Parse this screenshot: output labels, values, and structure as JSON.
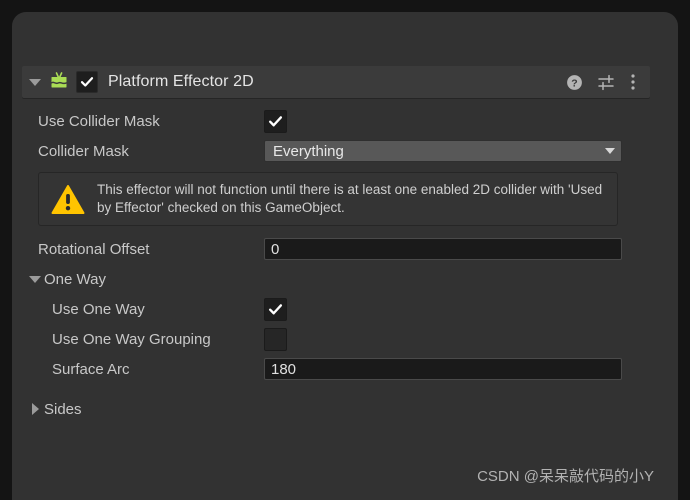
{
  "component": {
    "title": "Platform Effector 2D",
    "icon_name": "platform-effector-2d-icon",
    "enabled": true,
    "expanded": true,
    "tools": {
      "help_label": "?",
      "help_icon": "help-icon",
      "preset_icon": "preset-settings-icon",
      "menu_icon": "more-options-icon"
    }
  },
  "properties": {
    "use_collider_mask": {
      "label": "Use Collider Mask",
      "checked": true
    },
    "collider_mask": {
      "label": "Collider Mask",
      "value": "Everything"
    },
    "rotational_offset": {
      "label": "Rotational Offset",
      "value": "0"
    },
    "surface_arc": {
      "label": "Surface Arc",
      "value": "180"
    },
    "use_one_way": {
      "label": "Use One Way",
      "checked": true
    },
    "use_one_way_grouping": {
      "label": "Use One Way Grouping",
      "checked": false
    }
  },
  "warning": {
    "icon_name": "warning-triangle-icon",
    "text": "This effector will not function until there is at least one enabled 2D collider with 'Used by Effector' checked on this GameObject."
  },
  "sections": {
    "one_way": {
      "label": "One Way",
      "expanded": true
    },
    "sides": {
      "label": "Sides",
      "expanded": false
    }
  },
  "watermark": {
    "text": "CSDN @呆呆敲代码的小Y"
  },
  "colors": {
    "panel_bg": "#323232",
    "header_bg": "#3b3b3b",
    "field_bg": "#1a1a1a",
    "dropdown_bg": "#585858",
    "icon_green": "#aadd55",
    "warning_yellow": "#ffc400",
    "text": "#c8c8c8"
  }
}
